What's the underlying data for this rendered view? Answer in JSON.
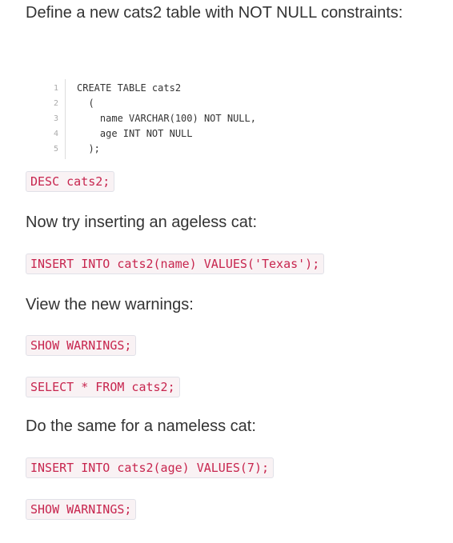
{
  "intro": "Define a new cats2 table with NOT NULL constraints:",
  "code_block": {
    "line_numbers": [
      "1",
      "2",
      "3",
      "4",
      "5"
    ],
    "lines": [
      "CREATE TABLE cats2",
      "  (",
      "    name VARCHAR(100) NOT NULL,",
      "    age INT NOT NULL",
      "  );"
    ]
  },
  "snippet_desc": "DESC cats2;",
  "para_ageless": "Now try inserting an ageless cat:",
  "snippet_insert_name": "INSERT INTO cats2(name) VALUES('Texas');",
  "para_warnings": "View the new warnings:",
  "snippet_show_warnings_1": "SHOW WARNINGS;",
  "snippet_select": "SELECT * FROM cats2;",
  "para_nameless": "Do the same for a nameless cat:",
  "snippet_insert_age": "INSERT INTO cats2(age) VALUES(7);",
  "snippet_show_warnings_2": "SHOW WARNINGS;"
}
